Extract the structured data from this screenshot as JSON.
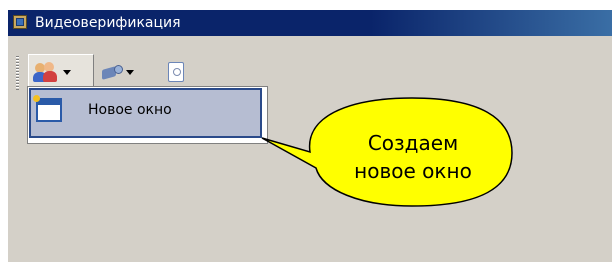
{
  "window": {
    "title": "Видеоверификация"
  },
  "toolbar": {
    "buttons": [
      {
        "icon": "users-icon",
        "has_dropdown": true
      },
      {
        "icon": "camera-icon",
        "has_dropdown": true
      },
      {
        "icon": "document-icon",
        "has_dropdown": false
      }
    ]
  },
  "dropdown_menu": {
    "items": [
      {
        "label": "Новое окно",
        "icon": "new-window-icon"
      }
    ]
  },
  "callout": {
    "line1": "Создаем",
    "line2": "новое окно",
    "fill_color": "#ffff00"
  },
  "colors": {
    "titlebar": "#0a246a",
    "window_bg": "#d4d0c8",
    "menu_highlight": "#b6bdd2"
  }
}
